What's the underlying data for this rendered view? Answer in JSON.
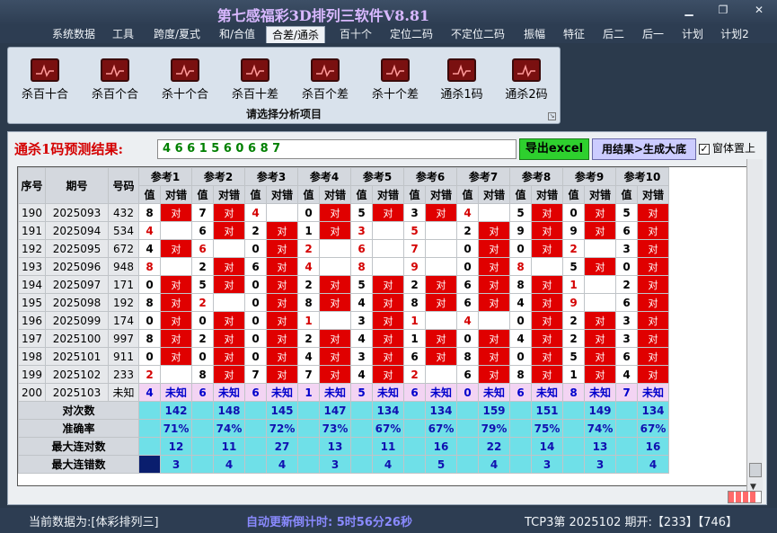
{
  "window": {
    "title": "第七感福彩3D排列三软件V8.81",
    "minimize_icon": "▁",
    "restore_icon": "❐",
    "close_icon": "✕"
  },
  "menu": [
    "系统数据",
    "工具",
    "跨度/夏式",
    "和/合值",
    "合差/通杀",
    "百十个",
    "定位二码",
    "不定位二码",
    "振幅",
    "特征",
    "后二",
    "后一",
    "计划",
    "计划2"
  ],
  "ribbon": {
    "buttons": [
      "杀百十合",
      "杀百个合",
      "杀十个合",
      "杀百十差",
      "杀百个差",
      "杀十个差",
      "通杀1码",
      "通杀2码"
    ],
    "caption": "请选择分析项目"
  },
  "prediction": {
    "label": "通杀1码预测结果:",
    "value": "4 6 6 1 5 6 0 6 8 7"
  },
  "buttons": {
    "excel": "导出excel",
    "generate": "用结果>生成大底"
  },
  "on_top": {
    "label": "窗体置上",
    "checked": true,
    "check_mark": "✓"
  },
  "table": {
    "headers": {
      "index": "序号",
      "period": "期号",
      "number": "号码",
      "value": "值",
      "correct": "对错"
    },
    "groups": [
      "参考1",
      "参考2",
      "参考3",
      "参考4",
      "参考5",
      "参考6",
      "参考7",
      "参考8",
      "参考9",
      "参考10"
    ],
    "hit_text": "对",
    "unknown_text": "未知",
    "rows": [
      {
        "idx": "190",
        "period": "2025093",
        "num": "432",
        "vals": [
          "8",
          "7",
          "4",
          "0",
          "5",
          "3",
          "4",
          "5",
          "0",
          "5"
        ],
        "hits": [
          1,
          1,
          0,
          1,
          1,
          1,
          0,
          1,
          1,
          1
        ]
      },
      {
        "idx": "191",
        "period": "2025094",
        "num": "534",
        "vals": [
          "4",
          "6",
          "2",
          "1",
          "3",
          "5",
          "2",
          "9",
          "9",
          "6"
        ],
        "hits": [
          0,
          1,
          1,
          1,
          0,
          0,
          1,
          1,
          1,
          1
        ]
      },
      {
        "idx": "192",
        "period": "2025095",
        "num": "672",
        "vals": [
          "4",
          "6",
          "0",
          "2",
          "6",
          "7",
          "0",
          "0",
          "2",
          "3"
        ],
        "hits": [
          1,
          0,
          1,
          0,
          0,
          0,
          1,
          1,
          0,
          1
        ]
      },
      {
        "idx": "193",
        "period": "2025096",
        "num": "948",
        "vals": [
          "8",
          "2",
          "6",
          "4",
          "8",
          "9",
          "0",
          "8",
          "5",
          "0"
        ],
        "hits": [
          0,
          1,
          1,
          0,
          0,
          0,
          1,
          0,
          1,
          1
        ]
      },
      {
        "idx": "194",
        "period": "2025097",
        "num": "171",
        "vals": [
          "0",
          "5",
          "0",
          "2",
          "5",
          "2",
          "6",
          "8",
          "1",
          "2"
        ],
        "hits": [
          1,
          1,
          1,
          1,
          1,
          1,
          1,
          1,
          0,
          1
        ]
      },
      {
        "idx": "195",
        "period": "2025098",
        "num": "192",
        "vals": [
          "8",
          "2",
          "0",
          "8",
          "4",
          "8",
          "6",
          "4",
          "9",
          "6"
        ],
        "hits": [
          1,
          0,
          1,
          1,
          1,
          1,
          1,
          1,
          0,
          1
        ]
      },
      {
        "idx": "196",
        "period": "2025099",
        "num": "174",
        "vals": [
          "0",
          "0",
          "0",
          "1",
          "3",
          "1",
          "4",
          "0",
          "2",
          "3"
        ],
        "hits": [
          1,
          1,
          1,
          0,
          1,
          0,
          0,
          1,
          1,
          1
        ]
      },
      {
        "idx": "197",
        "period": "2025100",
        "num": "997",
        "vals": [
          "8",
          "2",
          "0",
          "2",
          "4",
          "1",
          "0",
          "4",
          "2",
          "3"
        ],
        "hits": [
          1,
          1,
          1,
          1,
          1,
          1,
          1,
          1,
          1,
          1
        ]
      },
      {
        "idx": "198",
        "period": "2025101",
        "num": "911",
        "vals": [
          "0",
          "0",
          "0",
          "4",
          "3",
          "6",
          "8",
          "0",
          "5",
          "6"
        ],
        "hits": [
          1,
          1,
          1,
          1,
          1,
          1,
          1,
          1,
          1,
          1
        ]
      },
      {
        "idx": "199",
        "period": "2025102",
        "num": "233",
        "vals": [
          "2",
          "8",
          "7",
          "7",
          "4",
          "2",
          "6",
          "8",
          "1",
          "4"
        ],
        "hits": [
          0,
          1,
          1,
          1,
          1,
          0,
          1,
          1,
          1,
          1
        ]
      },
      {
        "idx": "200",
        "period": "2025103",
        "num": "未知",
        "vals": [
          "4",
          "6",
          "6",
          "1",
          "5",
          "6",
          "0",
          "6",
          "8",
          "7"
        ],
        "hits": []
      }
    ],
    "red_values": [
      [
        "8",
        "4",
        "4",
        "8",
        "2"
      ],
      [
        "6",
        "2"
      ],
      [
        "4"
      ],
      [
        "2",
        "1"
      ],
      [
        "3",
        "6",
        "8"
      ],
      [
        "3",
        "5",
        "7",
        "9",
        "1",
        "2"
      ],
      [
        "4",
        "4"
      ],
      [
        "8"
      ],
      [
        "2",
        "9"
      ],
      []
    ],
    "stats": [
      {
        "label": "对次数",
        "values": [
          "142",
          "148",
          "145",
          "147",
          "134",
          "134",
          "159",
          "151",
          "149",
          "134"
        ]
      },
      {
        "label": "准确率",
        "values": [
          "71%",
          "74%",
          "72%",
          "73%",
          "67%",
          "67%",
          "79%",
          "75%",
          "74%",
          "67%"
        ]
      },
      {
        "label": "最大连对数",
        "values": [
          "12",
          "11",
          "27",
          "13",
          "11",
          "16",
          "22",
          "14",
          "13",
          "16"
        ]
      },
      {
        "label": "最大连错数",
        "values": [
          "3",
          "4",
          "4",
          "3",
          "4",
          "5",
          "4",
          "3",
          "3",
          "4"
        ]
      }
    ]
  },
  "vertical_scrollbar_arrow": "▼",
  "ribbon_expand_icon": "↘",
  "status": {
    "data_source": "当前数据为:[体彩排列三]",
    "countdown": "自动更新倒计时: 5时56分26秒",
    "latest": "TCP3第 2025102 期开:【233】【746】"
  },
  "progress": 0.85
}
